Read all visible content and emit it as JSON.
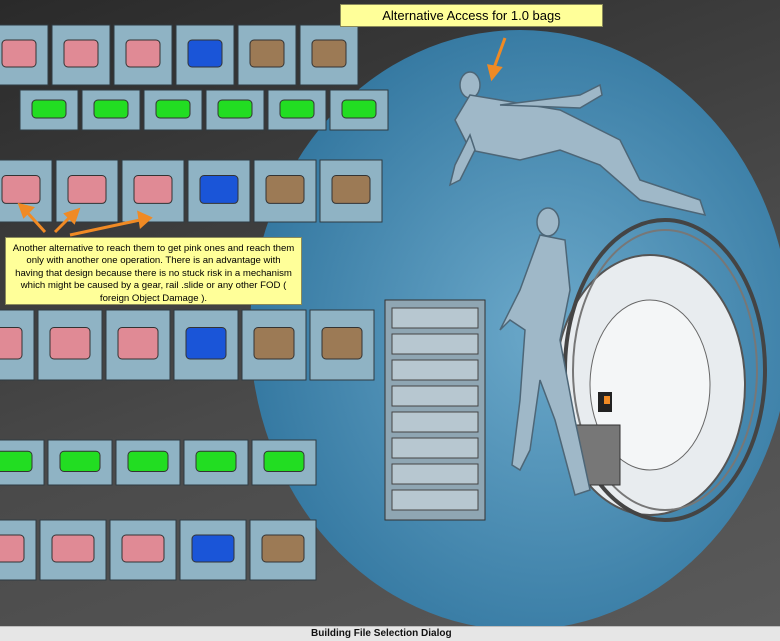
{
  "annotations": {
    "top_callout": "Alternative  Access for 1.0 bags",
    "bottom_callout": "Another alternative to reach them to get pink ones and reach them only with another one operation. There is an advantage with having that design because there is no stuck risk in a mechanism which might be caused by a gear, rail .slide or any other FOD ( foreign Object Damage )."
  },
  "statusbar": {
    "title": "Building File Selection Dialog"
  },
  "colors": {
    "callout_bg": "#ffff99",
    "arrow": "#f08a24",
    "module_face": "#8fb3c4",
    "pink_slot": "#e08a95",
    "green_slot": "#22dd22",
    "blue_slot": "#1a55d8",
    "brown_slot": "#9c7a55",
    "cylinder": "#3f8fbf"
  }
}
